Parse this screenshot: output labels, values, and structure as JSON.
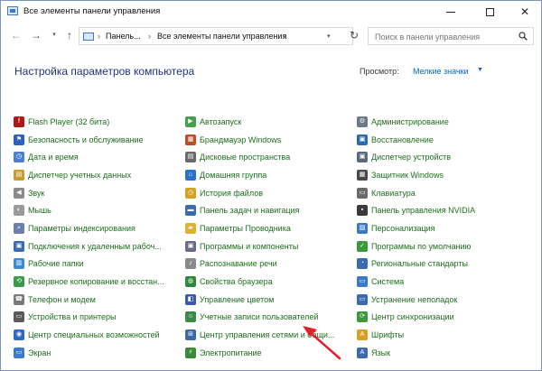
{
  "window": {
    "title": "Все элементы панели управления",
    "min_icon": "minimize-icon",
    "max_icon": "maximize-icon",
    "close_symbol": "✕"
  },
  "nav": {
    "back_symbol": "←",
    "forward_symbol": "→",
    "recent_symbol": "▾",
    "up_symbol": "↑",
    "address_segments": [
      "Панель...",
      "Все элементы панели управления"
    ],
    "address_sep": "›",
    "address_dropdown": "▾",
    "refresh_symbol": "↻",
    "search_placeholder": "Поиск в панели управления"
  },
  "header": {
    "title": "Настройка параметров компьютера",
    "view_label": "Просмотр:",
    "view_value": "Мелкие значки",
    "view_caret": "▼"
  },
  "colors": {
    "link": "#1a6e1a",
    "title": "#1e3287",
    "accent": "#0066cc",
    "arrow": "#e0202a"
  },
  "columns": [
    [
      {
        "label": "Flash Player (32 бита)",
        "icon": "flash-icon",
        "color": "#b01818",
        "glyph": "f"
      },
      {
        "label": "Безопасность и обслуживание",
        "icon": "flag-icon",
        "color": "#2a62c0",
        "glyph": "⚑"
      },
      {
        "label": "Дата и время",
        "icon": "clock-icon",
        "color": "#4a7fcf",
        "glyph": "◷"
      },
      {
        "label": "Диспетчер учетных данных",
        "icon": "credential-icon",
        "color": "#c89a30",
        "glyph": "▤"
      },
      {
        "label": "Звук",
        "icon": "speaker-icon",
        "color": "#8a8a8a",
        "glyph": "◀"
      },
      {
        "label": "Мышь",
        "icon": "mouse-icon",
        "color": "#9a9a9a",
        "glyph": "◐"
      },
      {
        "label": "Параметры индексирования",
        "icon": "indexing-icon",
        "color": "#6a7fa8",
        "glyph": "⌕"
      },
      {
        "label": "Подключения к удаленным рабоч...",
        "icon": "remote-desktop-icon",
        "color": "#3a6ab0",
        "glyph": "▣"
      },
      {
        "label": "Рабочие папки",
        "icon": "work-folders-icon",
        "color": "#3a8ad8",
        "glyph": "▥"
      },
      {
        "label": "Резервное копирование и восстан...",
        "icon": "backup-icon",
        "color": "#3a9a4a",
        "glyph": "⟲"
      },
      {
        "label": "Телефон и модем",
        "icon": "phone-icon",
        "color": "#7a7a7a",
        "glyph": "☎"
      },
      {
        "label": "Устройства и принтеры",
        "icon": "printer-icon",
        "color": "#5a5a5a",
        "glyph": "▭"
      },
      {
        "label": "Центр специальных возможностей",
        "icon": "accessibility-icon",
        "color": "#2a6ac8",
        "glyph": "◉"
      },
      {
        "label": "Экран",
        "icon": "display-icon",
        "color": "#3a7ad0",
        "glyph": "▭"
      }
    ],
    [
      {
        "label": "Автозапуск",
        "icon": "autoplay-icon",
        "color": "#4aa04a",
        "glyph": "▶"
      },
      {
        "label": "Брандмауэр Windows",
        "icon": "firewall-icon",
        "color": "#b8502a",
        "glyph": "▦"
      },
      {
        "label": "Дисковые пространства",
        "icon": "storage-icon",
        "color": "#6a6a6a",
        "glyph": "▤"
      },
      {
        "label": "Домашняя группа",
        "icon": "homegroup-icon",
        "color": "#2a72c8",
        "glyph": "⌂"
      },
      {
        "label": "История файлов",
        "icon": "file-history-icon",
        "color": "#d8a020",
        "glyph": "◷"
      },
      {
        "label": "Панель задач и навигация",
        "icon": "taskbar-icon",
        "color": "#3a6ab0",
        "glyph": "▬"
      },
      {
        "label": "Параметры Проводника",
        "icon": "explorer-options-icon",
        "color": "#e0b030",
        "glyph": "▰"
      },
      {
        "label": "Программы и компоненты",
        "icon": "programs-icon",
        "color": "#6a6a8a",
        "glyph": "▣"
      },
      {
        "label": "Распознавание речи",
        "icon": "microphone-icon",
        "color": "#8a8a8a",
        "glyph": "♪"
      },
      {
        "label": "Свойства браузера",
        "icon": "internet-options-icon",
        "color": "#2a8a3a",
        "glyph": "◍"
      },
      {
        "label": "Управление цветом",
        "icon": "color-management-icon",
        "color": "#3a5ab0",
        "glyph": "◧"
      },
      {
        "label": "Учетные записи пользователей",
        "icon": "user-accounts-icon",
        "color": "#3a8a4a",
        "glyph": "☺"
      },
      {
        "label": "Центр управления сетями и общи...",
        "icon": "network-icon",
        "color": "#3a6aa8",
        "glyph": "⊞"
      },
      {
        "label": "Электропитание",
        "icon": "power-icon",
        "color": "#3a8a3a",
        "glyph": "⚡"
      }
    ],
    [
      {
        "label": "Администрирование",
        "icon": "admin-tools-icon",
        "color": "#6a7a8a",
        "glyph": "⚙"
      },
      {
        "label": "Восстановление",
        "icon": "recovery-icon",
        "color": "#2a6ab0",
        "glyph": "▣"
      },
      {
        "label": "Диспетчер устройств",
        "icon": "device-manager-icon",
        "color": "#5a6a7a",
        "glyph": "▣"
      },
      {
        "label": "Защитник Windows",
        "icon": "defender-icon",
        "color": "#4a4a4a",
        "glyph": "▦"
      },
      {
        "label": "Клавиатура",
        "icon": "keyboard-icon",
        "color": "#6a6a6a",
        "glyph": "▭"
      },
      {
        "label": "Панель управления NVIDIA",
        "icon": "nvidia-icon",
        "color": "#3a3a3a",
        "glyph": "▪"
      },
      {
        "label": "Персонализация",
        "icon": "personalization-icon",
        "color": "#3a7ac0",
        "glyph": "▨"
      },
      {
        "label": "Программы по умолчанию",
        "icon": "default-programs-icon",
        "color": "#3a9a3a",
        "glyph": "✓"
      },
      {
        "label": "Региональные стандарты",
        "icon": "region-icon",
        "color": "#3a6ab0",
        "glyph": "◔"
      },
      {
        "label": "Система",
        "icon": "system-icon",
        "color": "#3a7ac8",
        "glyph": "▭"
      },
      {
        "label": "Устранение неполадок",
        "icon": "troubleshoot-icon",
        "color": "#3a6ab0",
        "glyph": "▭"
      },
      {
        "label": "Центр синхронизации",
        "icon": "sync-icon",
        "color": "#3a9a3a",
        "glyph": "⟳"
      },
      {
        "label": "Шрифты",
        "icon": "fonts-icon",
        "color": "#d8a020",
        "glyph": "A"
      },
      {
        "label": "Язык",
        "icon": "language-icon",
        "color": "#3a6ab0",
        "glyph": "A"
      }
    ]
  ]
}
